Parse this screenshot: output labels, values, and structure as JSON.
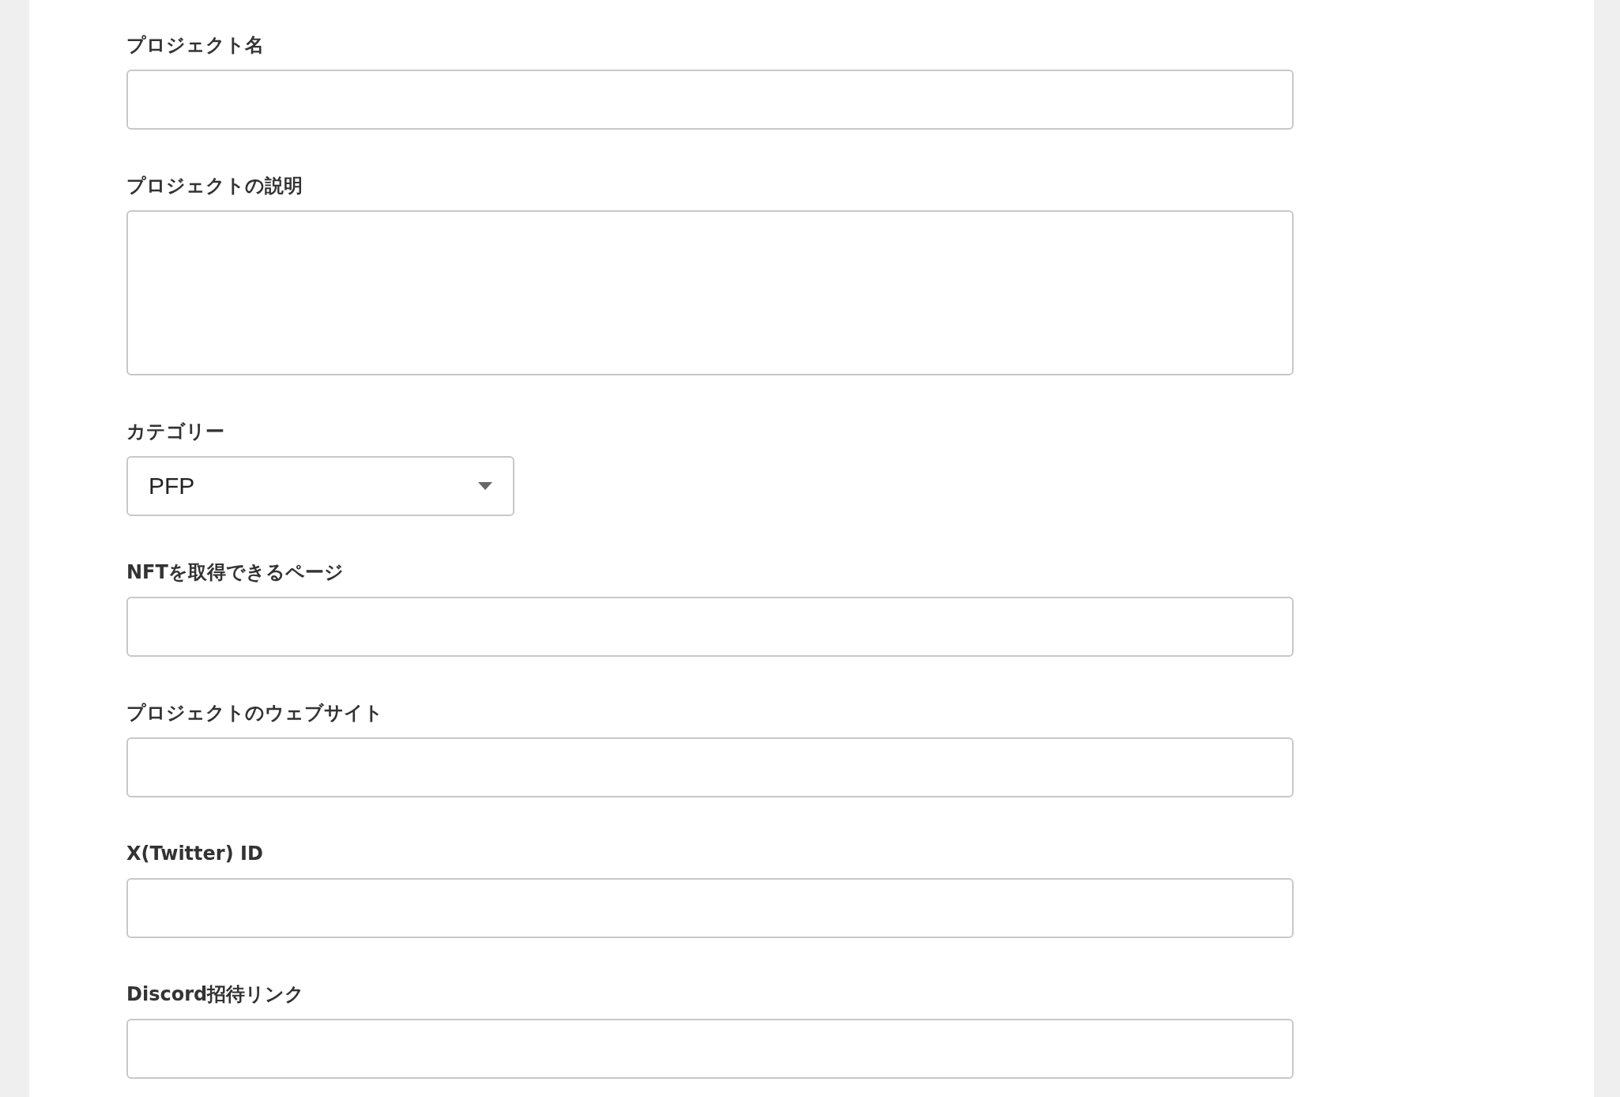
{
  "form": {
    "fields": [
      {
        "kind": "text",
        "label": "プロジェクト名"
      },
      {
        "kind": "textarea",
        "label": "プロジェクトの説明"
      },
      {
        "kind": "select",
        "label": "カテゴリー",
        "value": "PFP"
      },
      {
        "kind": "text",
        "label": "NFTを取得できるページ"
      },
      {
        "kind": "text",
        "label": "プロジェクトのウェブサイト"
      },
      {
        "kind": "text",
        "label": "X(Twitter) ID"
      },
      {
        "kind": "text",
        "label": "Discord招待リンク"
      }
    ]
  }
}
